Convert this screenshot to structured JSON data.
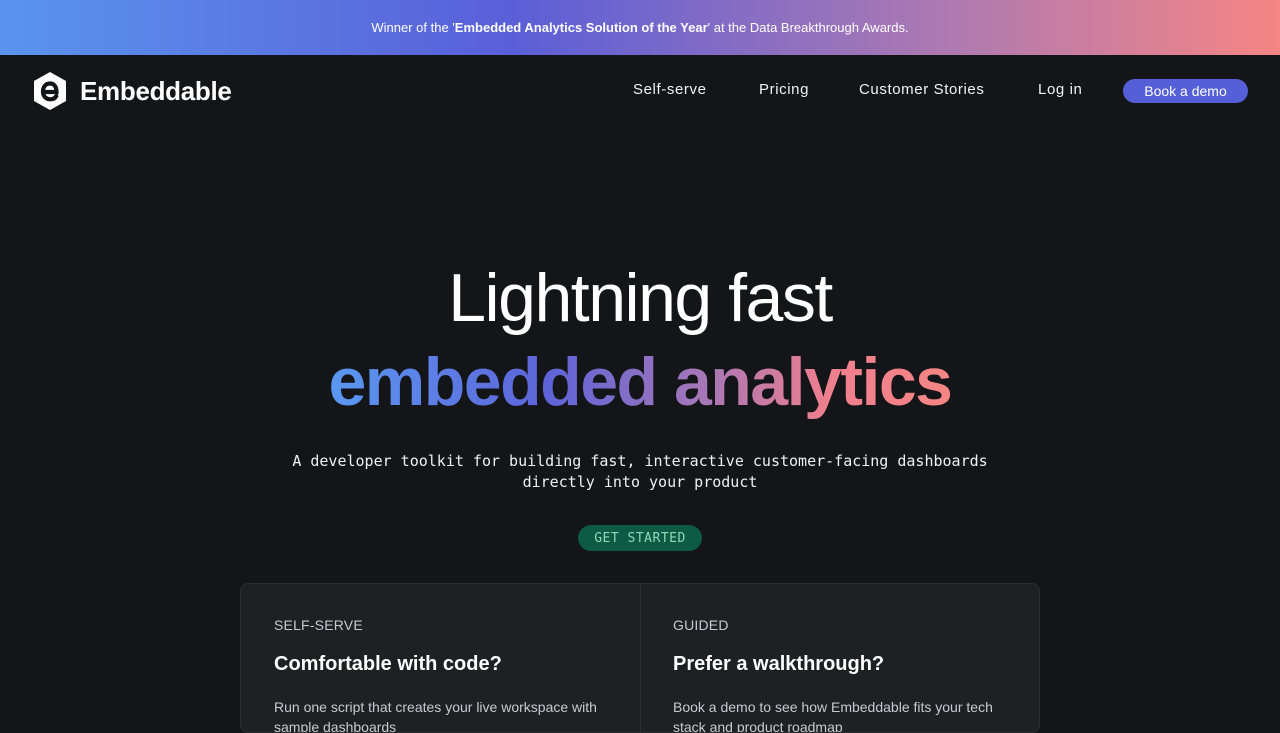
{
  "banner": {
    "prefix": "Winner of the '",
    "highlight": "Embedded Analytics Solution of the Year",
    "suffix": "' at the Data Breakthrough Awards."
  },
  "nav": {
    "logo_text": "Embeddable",
    "logo_icon": "embeddable-hexagon-logo",
    "links": [
      "Self-serve",
      "Pricing",
      "Customer Stories",
      "Log in"
    ],
    "cta_label": "Book a demo"
  },
  "hero": {
    "title_line1": "Lightning fast",
    "title_line2": "embedded analytics",
    "subtitle_line1": "A developer toolkit for building fast, interactive customer-facing dashboards",
    "subtitle_line2": "directly into your product",
    "cta_label": "GET STARTED"
  },
  "cards": [
    {
      "tag": "SELF-SERVE",
      "title": "Comfortable with code?",
      "text": "Run one script that creates your live workspace with sample dashboards"
    },
    {
      "tag": "GUIDED",
      "title": "Prefer a walkthrough?",
      "text": "Book a demo to see how Embeddable fits your tech stack and product roadmap"
    }
  ],
  "colors": {
    "background": "#141518",
    "accent_button": "#5560d8",
    "cta_bg": "#0d5a45",
    "cta_text": "#8fd9b6",
    "gradient_start": "#5a94f0",
    "gradient_end": "#f68584"
  }
}
